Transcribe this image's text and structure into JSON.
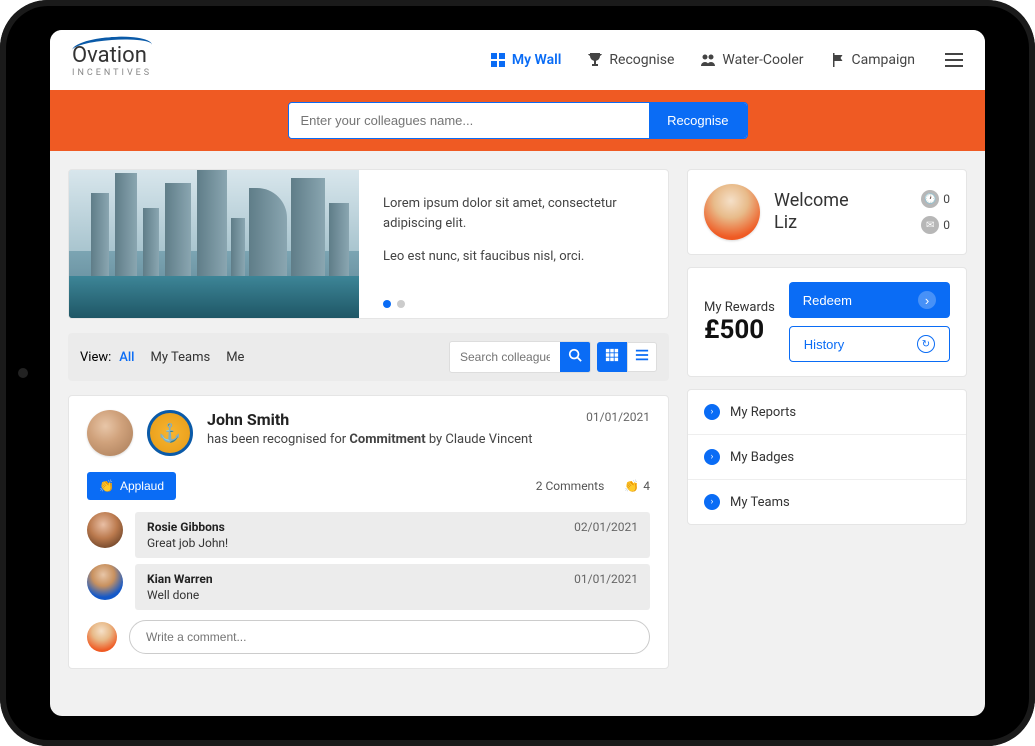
{
  "brand": {
    "name": "Ovation",
    "tagline": "INCENTIVES"
  },
  "nav": {
    "items": [
      {
        "label": "My Wall",
        "active": true
      },
      {
        "label": "Recognise"
      },
      {
        "label": "Water-Cooler"
      },
      {
        "label": "Campaign"
      }
    ]
  },
  "recogniseBar": {
    "placeholder": "Enter your colleagues name...",
    "button": "Recognise"
  },
  "hero": {
    "line1": "Lorem ipsum dolor sit amet, consectetur adipiscing elit.",
    "line2": "Leo est nunc, sit faucibus nisl, orci."
  },
  "filter": {
    "label": "View:",
    "tabs": [
      {
        "label": "All",
        "active": true
      },
      {
        "label": "My Teams"
      },
      {
        "label": "Me"
      }
    ],
    "searchPlaceholder": "Search colleagues"
  },
  "post": {
    "author": "John Smith",
    "date": "01/01/2021",
    "pre": "has been recognised for ",
    "value": "Commitment",
    "post": " by Claude Vincent",
    "applaud": "Applaud",
    "commentsCount": "2 Comments",
    "applaudCount": "4",
    "comments": [
      {
        "name": "Rosie Gibbons",
        "date": "02/01/2021",
        "text": "Great job John!"
      },
      {
        "name": "Kian Warren",
        "date": "01/01/2021",
        "text": "Well done"
      }
    ],
    "writePlaceholder": "Write a comment..."
  },
  "welcome": {
    "greeting": "Welcome",
    "name": "Liz",
    "clockCount": "0",
    "mailCount": "0"
  },
  "rewards": {
    "label": "My Rewards",
    "amount": "£500",
    "redeem": "Redeem",
    "history": "History"
  },
  "links": [
    {
      "label": "My Reports"
    },
    {
      "label": "My Badges"
    },
    {
      "label": "My Teams"
    }
  ]
}
